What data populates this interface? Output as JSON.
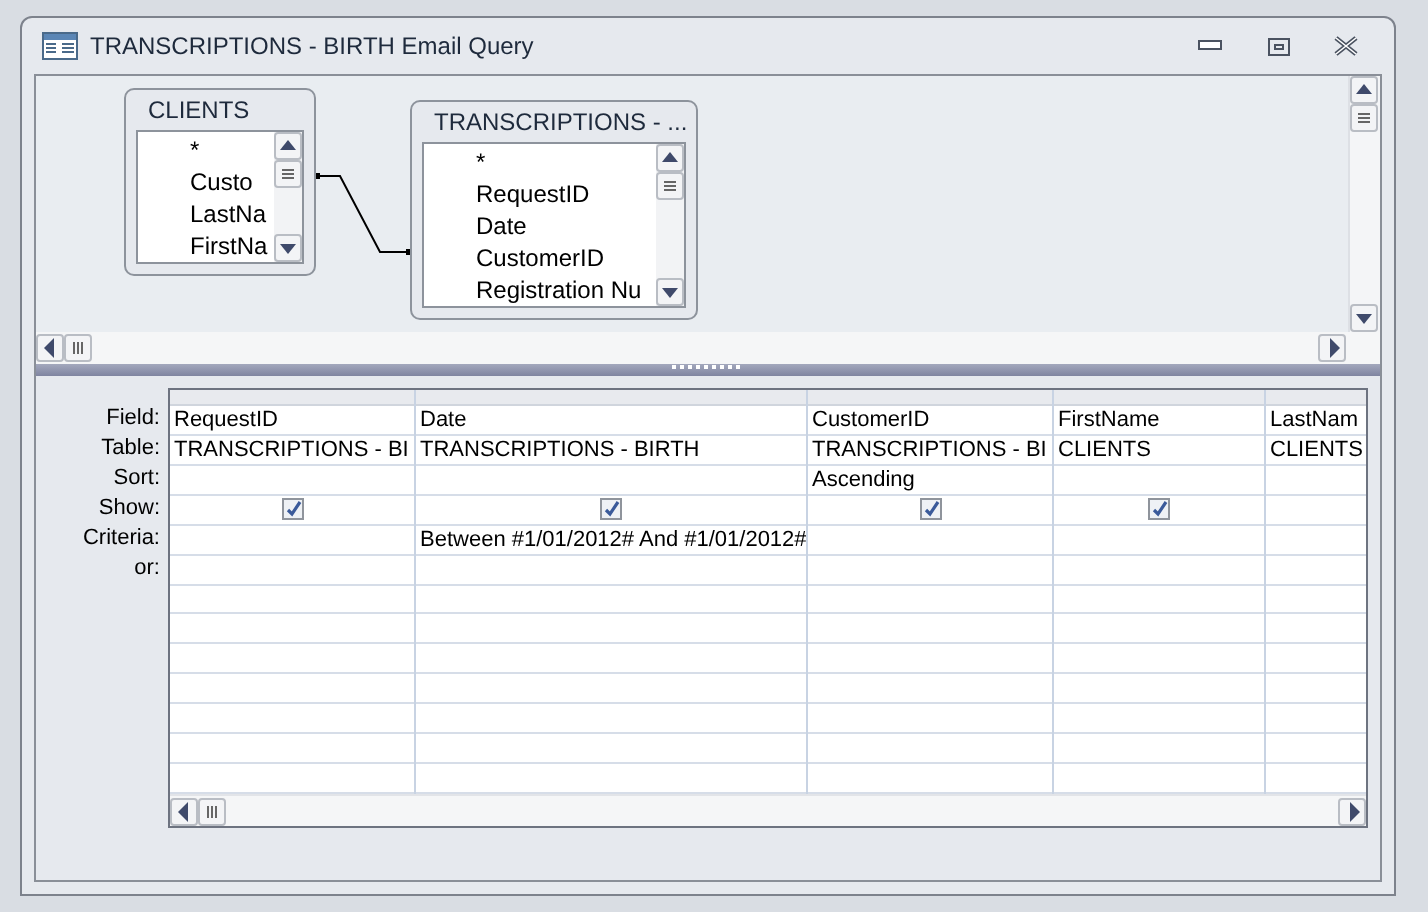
{
  "window": {
    "title": "TRANSCRIPTIONS - BIRTH Email Query"
  },
  "tables": [
    {
      "name": "CLIENTS",
      "fields": [
        "*",
        "Custo",
        "LastNa",
        "FirstNa"
      ]
    },
    {
      "name": "TRANSCRIPTIONS - ...",
      "fields": [
        "*",
        "RequestID",
        "Date",
        "CustomerID",
        "Registration Nu"
      ]
    }
  ],
  "grid": {
    "row_labels": [
      "Field:",
      "Table:",
      "Sort:",
      "Show:",
      "Criteria:",
      "or:"
    ],
    "columns": [
      {
        "field": "RequestID",
        "table": "TRANSCRIPTIONS - BI",
        "show": true
      },
      {
        "field": "Date",
        "table": "TRANSCRIPTIONS - BIRTH",
        "show": true,
        "criteria": "Between #1/01/2012# And #1/01/2012#"
      },
      {
        "field": "CustomerID",
        "table": "TRANSCRIPTIONS - BI",
        "sort": "Ascending",
        "show": true
      },
      {
        "field": "FirstName",
        "table": "CLIENTS",
        "show": true
      },
      {
        "field": "LastNam",
        "table": "CLIENTS",
        "show": false
      }
    ]
  }
}
